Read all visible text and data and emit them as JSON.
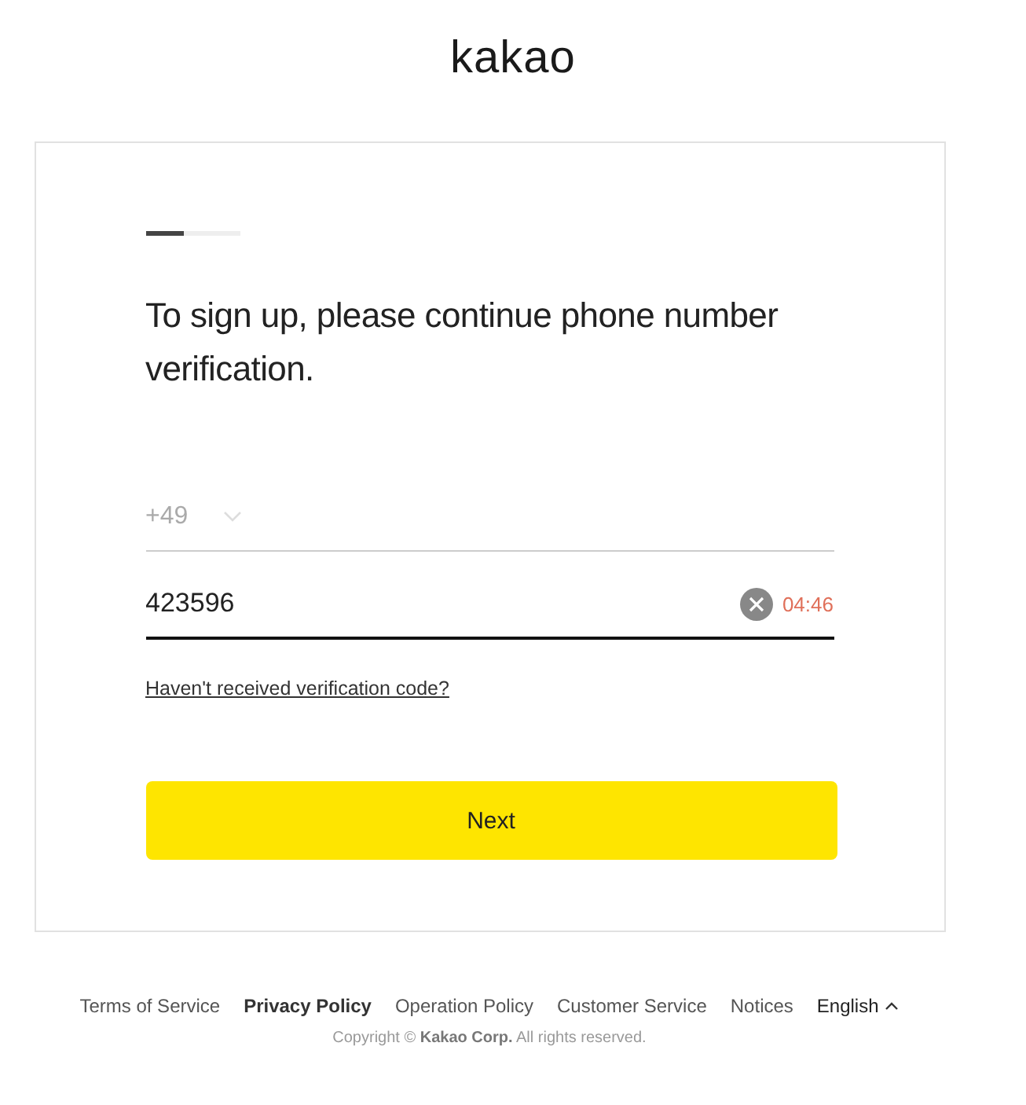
{
  "logo": "kakao",
  "progress": {
    "level": 0.4
  },
  "heading": "To sign up, please continue phone number verification.",
  "country_code": {
    "value": "+49"
  },
  "code_field": {
    "value": "423596",
    "timer": "04:46"
  },
  "resend_link": "Haven't received verification code?",
  "next_button": "Next",
  "footer": {
    "links": [
      {
        "label": "Terms of Service",
        "kind": "link",
        "emphasized": false
      },
      {
        "label": "Privacy Policy",
        "kind": "link",
        "emphasized": true
      },
      {
        "label": "Operation Policy",
        "kind": "link",
        "emphasized": false
      },
      {
        "label": "Customer Service",
        "kind": "link",
        "emphasized": false
      },
      {
        "label": "Notices",
        "kind": "link",
        "emphasized": false
      },
      {
        "label": "English",
        "kind": "language"
      }
    ],
    "copyright": "Copyright © **Kakao Corp.** All rights reserved."
  }
}
